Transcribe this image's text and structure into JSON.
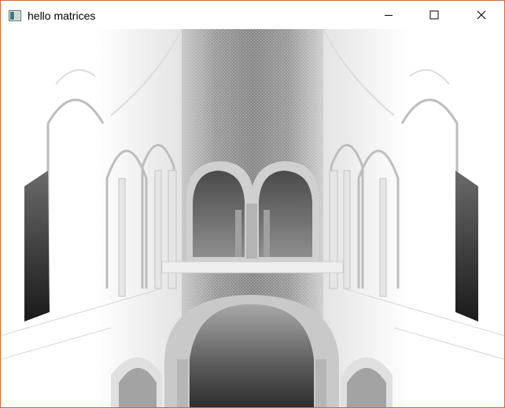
{
  "window": {
    "title": "hello matrices",
    "icon": "opengl-app-icon",
    "controls": [
      "minimize-icon",
      "maximize-icon",
      "close-icon"
    ]
  },
  "viewport": {
    "content": "rendered-3d-scene",
    "colors": {
      "background": "#ffffff",
      "stone_dark": "#3a3a3a",
      "stone_mid": "#9a9a9a",
      "stone_light": "#d8d8d8"
    }
  }
}
